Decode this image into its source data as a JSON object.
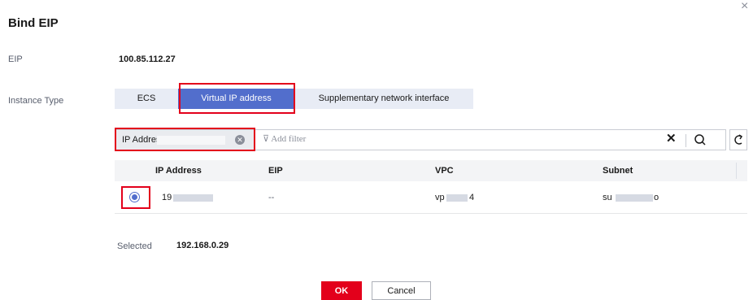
{
  "dialog": {
    "title": "Bind EIP"
  },
  "eip": {
    "label": "EIP",
    "value": "100.85.112.27"
  },
  "instance_type": {
    "label": "Instance Type",
    "options": [
      "ECS",
      "Virtual IP address",
      "Supplementary network interface"
    ],
    "selected": "Virtual IP address"
  },
  "filter": {
    "tag_label": "IP Address",
    "placeholder": "Add filter"
  },
  "table": {
    "columns": [
      "IP Address",
      "EIP",
      "VPC",
      "Subnet"
    ],
    "rows": [
      {
        "ip": "19",
        "eip": "--",
        "vpc_prefix": "vp",
        "vpc_suffix": "4",
        "subnet_prefix": "su",
        "subnet_suffix": "o",
        "selected": true
      }
    ]
  },
  "selected_info": {
    "label": "Selected",
    "value": "192.168.0.29"
  },
  "buttons": {
    "ok": "OK",
    "cancel": "Cancel"
  },
  "colors": {
    "accent": "#526ecc",
    "primary_button": "#e3001b",
    "highlight_box": "#e3001b"
  }
}
